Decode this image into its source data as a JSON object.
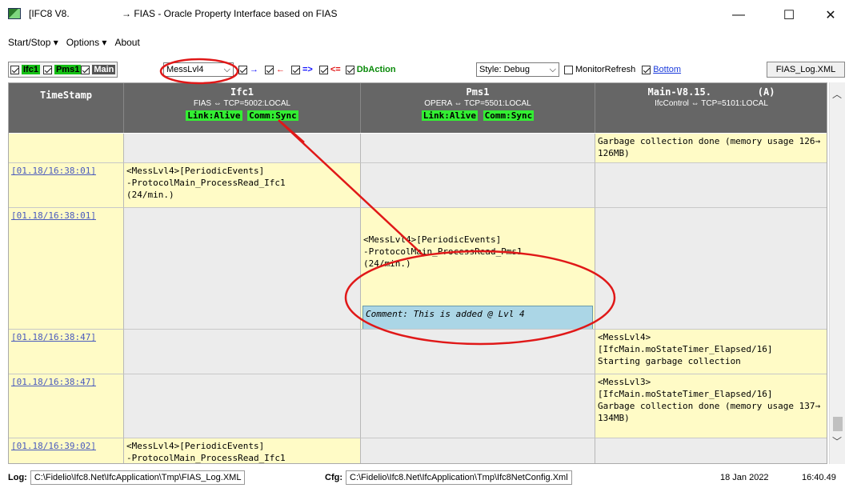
{
  "window": {
    "title_left": "[IFC8 V8.",
    "title_main": "→ FIAS - Oracle Property Interface based on FIAS",
    "minimize": "—",
    "maximize": "☐",
    "close": "✕"
  },
  "menu": {
    "items": [
      {
        "label": "Start/Stop ▾"
      },
      {
        "label": "Options ▾"
      },
      {
        "label": "About"
      }
    ]
  },
  "toolbar": {
    "ifc1": "Ifc1",
    "pms1": "Pms1",
    "main": "Main",
    "level_select": "MessLvl4",
    "arrow_right": "→",
    "arrow_left": "←",
    "arrow_double_right": "=>",
    "arrow_double_left": "<=",
    "dbaction": "DbAction",
    "style_select": "Style: Debug",
    "monitor_refresh": "MonitorRefresh",
    "bottom_link": "Bottom",
    "log_button": "FIAS_Log.XML"
  },
  "columns": [
    {
      "title": "TimeStamp",
      "sub": "",
      "status": []
    },
    {
      "title": "Ifc1",
      "sub": "FIAS ⇔ TCP=5002:LOCAL",
      "status": [
        "Link:Alive",
        "Comm:Sync"
      ]
    },
    {
      "title": "Pms1",
      "sub": "OPERA ⇔ TCP=5501:LOCAL",
      "status": [
        "Link:Alive",
        "Comm:Sync"
      ]
    },
    {
      "title": "Main-V8.15.        (A)",
      "sub": "IfcControl ⇔ TCP=5101:LOCAL",
      "status": []
    }
  ],
  "rows": [
    {
      "ts": "",
      "ifc1": "",
      "pms1": "",
      "main": "Garbage collection done (memory usage 126→126MB)"
    },
    {
      "ts": "[01.18/16:38:01]",
      "ifc1": "<MessLvl4>[PeriodicEvents]\n-ProtocolMain_ProcessRead_Ifc1\n(24/min.)",
      "pms1": "",
      "main": ""
    },
    {
      "ts": "[01.18/16:38:01]",
      "ifc1": "",
      "pms1": "<MessLvl4>[PeriodicEvents]\n-ProtocolMain_ProcessRead_Pms1\n(24/min.)",
      "pms1_comment": "Comment: This is added @ Lvl 4",
      "main": ""
    },
    {
      "ts": "[01.18/16:38:47]",
      "ifc1": "",
      "pms1": "",
      "main": "<MessLvl4>\n[IfcMain.moStateTimer_Elapsed/16]\nStarting garbage collection"
    },
    {
      "ts": "[01.18/16:38:47]",
      "ifc1": "",
      "pms1": "",
      "main": "<MessLvl3>\n[IfcMain.moStateTimer_Elapsed/16]\nGarbage collection done (memory usage 137→134MB)"
    },
    {
      "ts": "[01.18/16:39:02]",
      "ifc1": "<MessLvl4>[PeriodicEvents]\n-ProtocolMain_ProcessRead_Ifc1",
      "pms1": "",
      "main": ""
    }
  ],
  "status": {
    "log_label": "Log:",
    "log_path": "C:\\Fidelio\\Ifc8.Net\\IfcApplication\\Tmp\\FIAS_Log.XML",
    "cfg_label": "Cfg:",
    "cfg_path": "C:\\Fidelio\\Ifc8.Net\\IfcApplication\\Tmp\\Ifc8NetConfig.Xml",
    "date": "18 Jan 2022",
    "time": "16:40.49"
  },
  "colors": {
    "header_bg": "#666666",
    "status_green": "#33ee33",
    "row_yellow": "#fffbc6",
    "comment_blue": "#abd6e6",
    "annotation_red": "#e01818"
  }
}
